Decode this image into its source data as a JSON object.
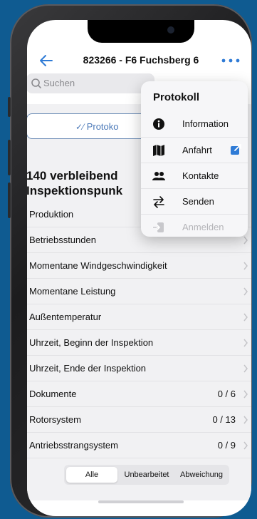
{
  "header": {
    "title": "823266 - F6 Fuchsberg 6"
  },
  "search": {
    "placeholder": "Suchen"
  },
  "protocol_button": {
    "label": "Protoko"
  },
  "heading": {
    "line1": "140 verbleibend",
    "line2": "Inspektionspunk"
  },
  "list": {
    "rows": [
      {
        "label": "Produktion",
        "count": ""
      },
      {
        "label": "Betriebsstunden",
        "count": ""
      },
      {
        "label": "Momentane Windgeschwindigkeit",
        "count": ""
      },
      {
        "label": "Momentane Leistung",
        "count": ""
      },
      {
        "label": "Außentemperatur",
        "count": ""
      },
      {
        "label": "Uhrzeit, Beginn der Inspektion",
        "count": ""
      },
      {
        "label": "Uhrzeit, Ende der Inspektion",
        "count": ""
      },
      {
        "label": "Dokumente",
        "count": "0 / 6"
      },
      {
        "label": "Rotorsystem",
        "count": "0 / 13"
      },
      {
        "label": "Antriebsstrangsystem",
        "count": "0 / 9"
      }
    ]
  },
  "segments": {
    "all": "Alle",
    "unedited": "Unbearbeitet",
    "deviation": "Abweichung"
  },
  "menu": {
    "title": "Protokoll",
    "items": [
      {
        "label": "Information",
        "icon": "info-icon"
      },
      {
        "label": "Anfahrt",
        "icon": "map-icon"
      },
      {
        "label": "Kontakte",
        "icon": "contacts-icon"
      },
      {
        "label": "Senden",
        "icon": "send-icon"
      },
      {
        "label": "Anmelden",
        "icon": "login-icon"
      }
    ]
  },
  "colors": {
    "accent": "#2f7bd6",
    "background": "#0f5b91"
  }
}
